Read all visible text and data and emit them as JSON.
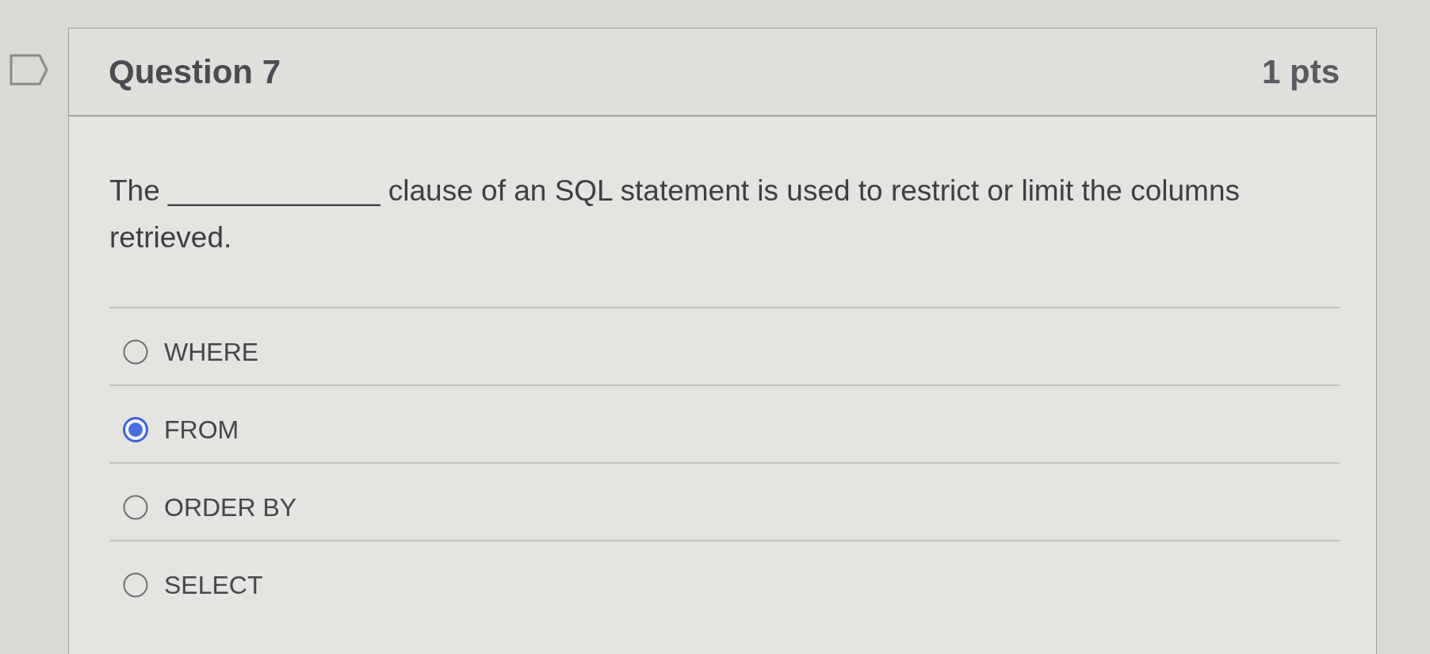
{
  "question": {
    "title": "Question 7",
    "points": "1 pts"
  },
  "prompt": "The _____________ clause of an SQL statement is used to restrict or limit the columns retrieved.",
  "answers": [
    {
      "label": "WHERE",
      "selected": false
    },
    {
      "label": "FROM",
      "selected": true
    },
    {
      "label": "ORDER BY",
      "selected": false
    },
    {
      "label": "SELECT",
      "selected": false
    }
  ]
}
